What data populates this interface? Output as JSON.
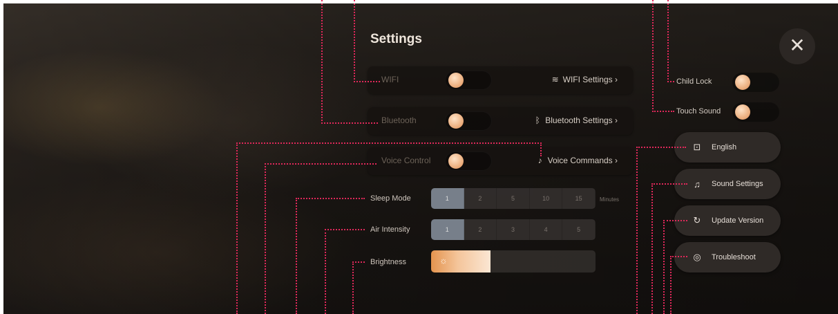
{
  "panel": {
    "title": "Settings"
  },
  "rows": {
    "wifi": {
      "label": "WIFI",
      "link": "WIFI Settings ›",
      "icon": "wifi-icon",
      "icon_glyph": "≋"
    },
    "bluetooth": {
      "label": "Bluetooth",
      "link": "Bluetooth Settings ›",
      "icon": "bluetooth-icon",
      "icon_glyph": "ᛒ"
    },
    "voice": {
      "label": "Voice Control",
      "link": "Voice Commands ›",
      "icon": "microphone-icon",
      "icon_glyph": "♪"
    }
  },
  "sleep": {
    "label": "Sleep Mode",
    "options": [
      "1",
      "2",
      "5",
      "10",
      "15"
    ],
    "selected": "1",
    "unit": "Minutes"
  },
  "air": {
    "label": "Air Intensity",
    "options": [
      "1",
      "2",
      "3",
      "4",
      "5"
    ],
    "selected": "1"
  },
  "brightness": {
    "label": "Brightness",
    "level_percent": 36,
    "icon": "sun-icon",
    "icon_glyph": "☼"
  },
  "side": {
    "child_lock": "Child Lock",
    "touch_sound": "Touch Sound",
    "language": {
      "label": "English",
      "icon": "language-icon",
      "icon_glyph": "⊡"
    },
    "sound_settings": {
      "label": "Sound Settings",
      "icon": "sound-icon",
      "icon_glyph": "♫"
    },
    "update_version": {
      "label": "Update Version",
      "icon": "refresh-icon",
      "icon_glyph": "↻"
    },
    "troubleshoot": {
      "label": "Troubleshoot",
      "icon": "troubleshoot-icon",
      "icon_glyph": "◎"
    }
  },
  "close": {
    "icon": "close-icon",
    "glyph": "✕"
  },
  "colors": {
    "accent": "#e9a876",
    "guide": "#e0285a",
    "panel": "#16120f"
  }
}
